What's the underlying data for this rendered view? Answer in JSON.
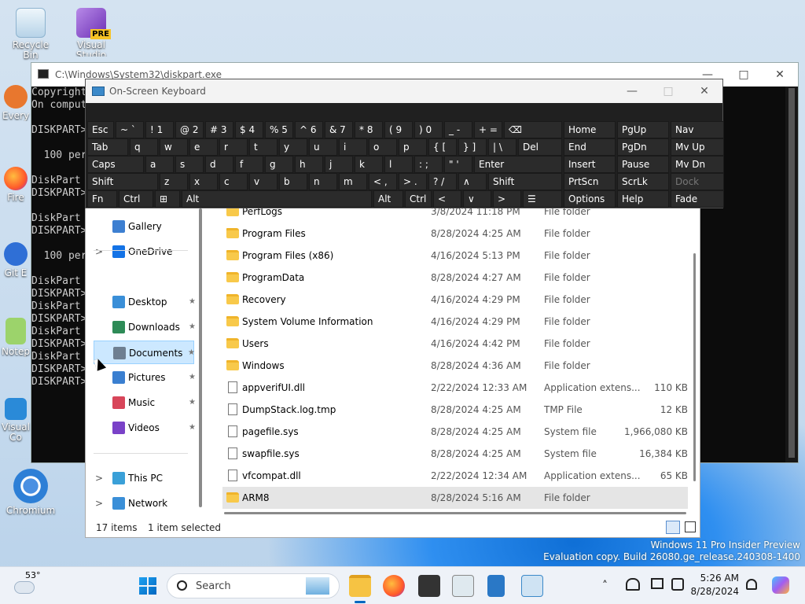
{
  "desktop": {
    "icons": [
      {
        "label": "Recycle Bin"
      },
      {
        "label": "Visual Studio"
      },
      {
        "label": "Every"
      },
      {
        "label": "Fire"
      },
      {
        "label": "Git E"
      },
      {
        "label": "Notep"
      },
      {
        "label": "Visual Co"
      },
      {
        "label": "Chromium"
      }
    ],
    "vs_badge": "PRE",
    "watermark": [
      "Windows 11 Pro Insider Preview",
      "Evaluation copy. Build 26080.ge_release.240308-1400"
    ]
  },
  "cmd": {
    "title": "C:\\Windows\\System32\\diskpart.exe",
    "lines": [
      "Copyright",
      "On comput",
      "",
      "DISKPART>",
      "",
      "  100 per",
      "",
      "DiskPart",
      "DISKPART>",
      "",
      "DiskPart",
      "DISKPART>",
      "",
      "  100 per",
      "",
      "DiskPart",
      "DISKPART>",
      "DiskPart",
      "DISKPART>",
      "DiskPart",
      "DISKPART>",
      "DiskPart",
      "DISKPART>",
      "DISKPART>"
    ]
  },
  "osk": {
    "title": "On-Screen Keyboard"
  },
  "explorer": {
    "nav": [
      {
        "label": "Gallery",
        "expand": ""
      },
      {
        "label": "OneDrive",
        "expand": ">"
      },
      {
        "label": "Desktop",
        "pin": "★"
      },
      {
        "label": "Downloads",
        "pin": "★"
      },
      {
        "label": "Documents",
        "pin": "★"
      },
      {
        "label": "Pictures",
        "pin": "★"
      },
      {
        "label": "Music",
        "pin": "★"
      },
      {
        "label": "Videos",
        "pin": "★"
      },
      {
        "label": "This PC",
        "expand": ">"
      },
      {
        "label": "Network",
        "expand": ">"
      }
    ],
    "files": [
      {
        "name": "PerfLogs",
        "date": "3/8/2024 11:18 PM",
        "type": "File folder",
        "size": "",
        "kind": "folder"
      },
      {
        "name": "Program Files",
        "date": "8/28/2024 4:25 AM",
        "type": "File folder",
        "size": "",
        "kind": "folder"
      },
      {
        "name": "Program Files (x86)",
        "date": "4/16/2024 5:13 PM",
        "type": "File folder",
        "size": "",
        "kind": "folder"
      },
      {
        "name": "ProgramData",
        "date": "8/28/2024 4:27 AM",
        "type": "File folder",
        "size": "",
        "kind": "folder"
      },
      {
        "name": "Recovery",
        "date": "4/16/2024 4:29 PM",
        "type": "File folder",
        "size": "",
        "kind": "folder"
      },
      {
        "name": "System Volume Information",
        "date": "4/16/2024 4:29 PM",
        "type": "File folder",
        "size": "",
        "kind": "folder"
      },
      {
        "name": "Users",
        "date": "4/16/2024 4:42 PM",
        "type": "File folder",
        "size": "",
        "kind": "folder"
      },
      {
        "name": "Windows",
        "date": "8/28/2024 4:36 AM",
        "type": "File folder",
        "size": "",
        "kind": "folder"
      },
      {
        "name": "appverifUI.dll",
        "date": "2/22/2024 12:33 AM",
        "type": "Application extens...",
        "size": "110 KB",
        "kind": "file"
      },
      {
        "name": "DumpStack.log.tmp",
        "date": "8/28/2024 4:25 AM",
        "type": "TMP File",
        "size": "12 KB",
        "kind": "file"
      },
      {
        "name": "pagefile.sys",
        "date": "8/28/2024 4:25 AM",
        "type": "System file",
        "size": "1,966,080 KB",
        "kind": "file"
      },
      {
        "name": "swapfile.sys",
        "date": "8/28/2024 4:25 AM",
        "type": "System file",
        "size": "16,384 KB",
        "kind": "file"
      },
      {
        "name": "vfcompat.dll",
        "date": "2/22/2024 12:34 AM",
        "type": "Application extens...",
        "size": "65 KB",
        "kind": "file"
      },
      {
        "name": "ARM8",
        "date": "8/28/2024 5:16 AM",
        "type": "File folder",
        "size": "",
        "kind": "folder"
      }
    ],
    "status": {
      "items": "17 items",
      "selected": "1 item selected"
    }
  },
  "taskbar": {
    "weather_temp": "53°",
    "search_placeholder": "Search",
    "time": "5:26 AM",
    "date": "8/28/2024"
  }
}
